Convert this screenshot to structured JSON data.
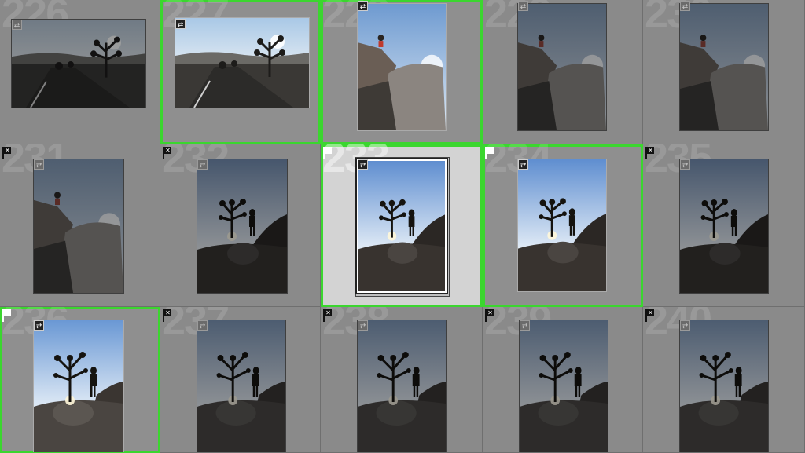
{
  "grid": {
    "cells": [
      {
        "index": "226",
        "flag": "",
        "scene": "road",
        "orientation": "landscape",
        "state": "dim",
        "selected": false,
        "active": false
      },
      {
        "index": "227",
        "flag": "",
        "scene": "road",
        "orientation": "landscape",
        "state": "bright",
        "selected": true,
        "active": false
      },
      {
        "index": "228",
        "flag": "",
        "scene": "rocks",
        "orientation": "portrait",
        "state": "bright",
        "selected": true,
        "active": false
      },
      {
        "index": "229",
        "flag": "",
        "scene": "rocks",
        "orientation": "portrait",
        "state": "dim",
        "selected": false,
        "active": false
      },
      {
        "index": "230",
        "flag": "",
        "scene": "rocks",
        "orientation": "portrait",
        "state": "dim",
        "selected": false,
        "active": false
      },
      {
        "index": "231",
        "flag": "rejected",
        "scene": "rocks",
        "orientation": "portrait",
        "state": "dim",
        "selected": false,
        "active": false
      },
      {
        "index": "232",
        "flag": "rejected",
        "scene": "tree",
        "orientation": "portrait",
        "state": "dim",
        "selected": false,
        "active": false
      },
      {
        "index": "233",
        "flag": "picked",
        "scene": "tree",
        "orientation": "portrait",
        "state": "bright",
        "selected": true,
        "active": true
      },
      {
        "index": "234",
        "flag": "picked",
        "scene": "tree",
        "orientation": "portrait",
        "state": "bright",
        "selected": true,
        "active": false
      },
      {
        "index": "235",
        "flag": "rejected",
        "scene": "tree",
        "orientation": "portrait",
        "state": "dim",
        "selected": false,
        "active": false
      },
      {
        "index": "236",
        "flag": "picked",
        "scene": "tree2",
        "orientation": "portrait",
        "state": "bright",
        "selected": true,
        "active": false
      },
      {
        "index": "237",
        "flag": "rejected",
        "scene": "tree2",
        "orientation": "portrait",
        "state": "dim",
        "selected": false,
        "active": false
      },
      {
        "index": "238",
        "flag": "rejected",
        "scene": "tree2",
        "orientation": "portrait",
        "state": "dim",
        "selected": false,
        "active": false
      },
      {
        "index": "239",
        "flag": "rejected",
        "scene": "tree2",
        "orientation": "portrait",
        "state": "dim",
        "selected": false,
        "active": false
      },
      {
        "index": "240",
        "flag": "rejected",
        "scene": "tree2",
        "orientation": "portrait",
        "state": "dim",
        "selected": false,
        "active": false
      }
    ]
  },
  "icons": {
    "flag_rejected": "flag-rejected-icon",
    "flag_picked": "flag-picked-icon",
    "edit_badge": "develop-adjustments-icon",
    "reject_glyph": "✕"
  },
  "colors": {
    "selection": "#3bd62f",
    "grid_bg": "#8f8f8f",
    "active_cell": "#d3d3d3"
  }
}
